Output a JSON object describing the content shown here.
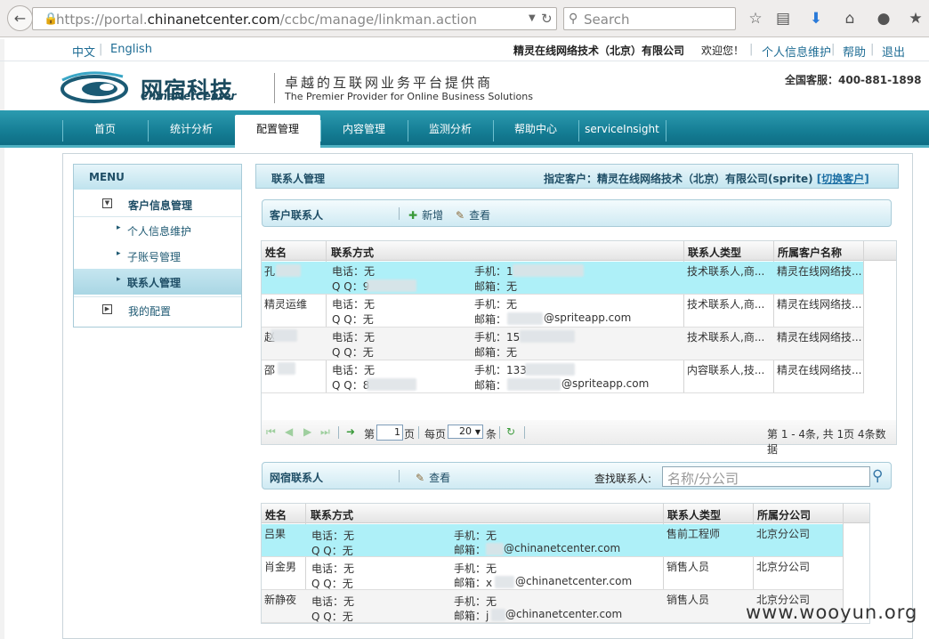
{
  "browser": {
    "url_prefix": "https://portal.",
    "url_domain": "chinanetcenter.com",
    "url_path": "/ccbc/manage/linkman.action",
    "search_placeholder": "Search"
  },
  "toplinks": {
    "lang_cn": "中文",
    "lang_en": "English",
    "company": "精灵在线网络技术（北京）有限公司",
    "welcome": "欢迎您！",
    "profile": "个人信息维护",
    "help": "帮助",
    "logout": "退出"
  },
  "header": {
    "brand_cn": "网宿科技",
    "brand_en": "ChinaNetCenter",
    "tagline_cn": "卓越的互联网业务平台提供商",
    "tagline_en": "The Premier Provider for Online Business Solutions",
    "hotline": "全国客服：400-881-1898"
  },
  "nav": [
    "首页",
    "统计分析",
    "配置管理",
    "内容管理",
    "监测分析",
    "帮助中心",
    "serviceInsight"
  ],
  "menu": {
    "title": "MENU",
    "group1": "客户信息管理",
    "items": [
      "个人信息维护",
      "子账号管理",
      "联系人管理"
    ],
    "group2": "我的配置"
  },
  "panel": {
    "title": "联系人管理",
    "customer_label": "指定客户：精灵在线网络技术（北京）有限公司(sprite)",
    "switch": "[切换客户]"
  },
  "customer_contacts": {
    "title": "客户联系人",
    "add": "新增",
    "view": "查看",
    "headers": [
      "姓名",
      "联系方式",
      "联系人类型",
      "所属客户名称"
    ],
    "rows": [
      {
        "name": "孔",
        "phone": "电话：无",
        "qq": "Q Q：9",
        "mobile": "手机：1",
        "email": "邮箱：无",
        "type": "技术联系人,商...",
        "customer": "精灵在线网络技..."
      },
      {
        "name": "精灵运维",
        "phone": "电话：无",
        "qq": "Q Q：无",
        "mobile": "手机：无",
        "email": "邮箱：",
        "email_domain": "@spriteapp.com",
        "type": "技术联系人,商...",
        "customer": "精灵在线网络技..."
      },
      {
        "name": "赵",
        "phone": "电话：无",
        "qq": "Q Q：无",
        "mobile": "手机：15",
        "email": "邮箱：无",
        "type": "技术联系人,商...",
        "customer": "精灵在线网络技..."
      },
      {
        "name": "邵",
        "phone": "电话：无",
        "qq": "Q Q：8",
        "mobile": "手机：133",
        "email": "邮箱：",
        "email_domain": "@spriteapp.com",
        "type": "内容联系人,技...",
        "customer": "精灵在线网络技..."
      }
    ],
    "pager": {
      "page_label": "第",
      "page_value": "1",
      "page_suffix": "页",
      "per_label": "每页",
      "per_value": "20",
      "per_suffix": "条",
      "summary": "第 1 - 4条, 共 1页 4条数据"
    }
  },
  "wangsu_contacts": {
    "title": "网宿联系人",
    "view": "查看",
    "find_label": "查找联系人:",
    "find_placeholder": "名称/分公司",
    "headers": [
      "姓名",
      "联系方式",
      "联系人类型",
      "所属分公司"
    ],
    "rows": [
      {
        "name": "吕果",
        "phone": "电话：无",
        "qq": "Q Q：无",
        "mobile": "手机：无",
        "email": "邮箱：",
        "email_domain": "@chinanetcenter.com",
        "type": "售前工程师",
        "branch": "北京分公司"
      },
      {
        "name": "肖金男",
        "phone": "电话：无",
        "qq": "Q Q：无",
        "mobile": "手机：无",
        "email": "邮箱：x",
        "email_domain": "@chinanetcenter.com",
        "type": "销售人员",
        "branch": "北京分公司"
      },
      {
        "name": "新静夜",
        "phone": "电话：无",
        "qq": "Q Q：无",
        "mobile": "手机：无",
        "email": "邮箱：j",
        "email_domain": "@chinanetcenter.com",
        "type": "销售人员",
        "branch": "北京分公司"
      }
    ]
  },
  "watermark": "www.wooyun.org"
}
